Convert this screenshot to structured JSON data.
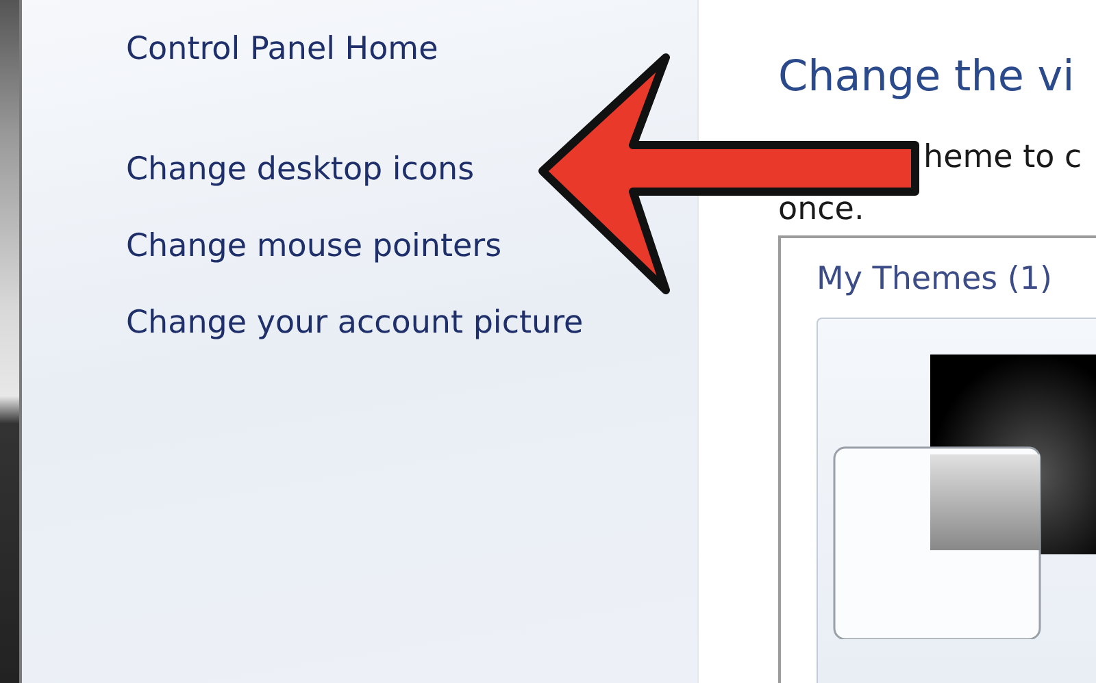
{
  "sidebar": {
    "links": [
      {
        "label": "Control Panel Home"
      },
      {
        "label": "Change desktop icons"
      },
      {
        "label": "Change mouse pointers"
      },
      {
        "label": "Change your account picture"
      }
    ]
  },
  "main": {
    "title": "Change the vi",
    "description_lines": [
      "heme to c",
      "once."
    ],
    "themes_group": {
      "heading": "My Themes (1)"
    }
  }
}
